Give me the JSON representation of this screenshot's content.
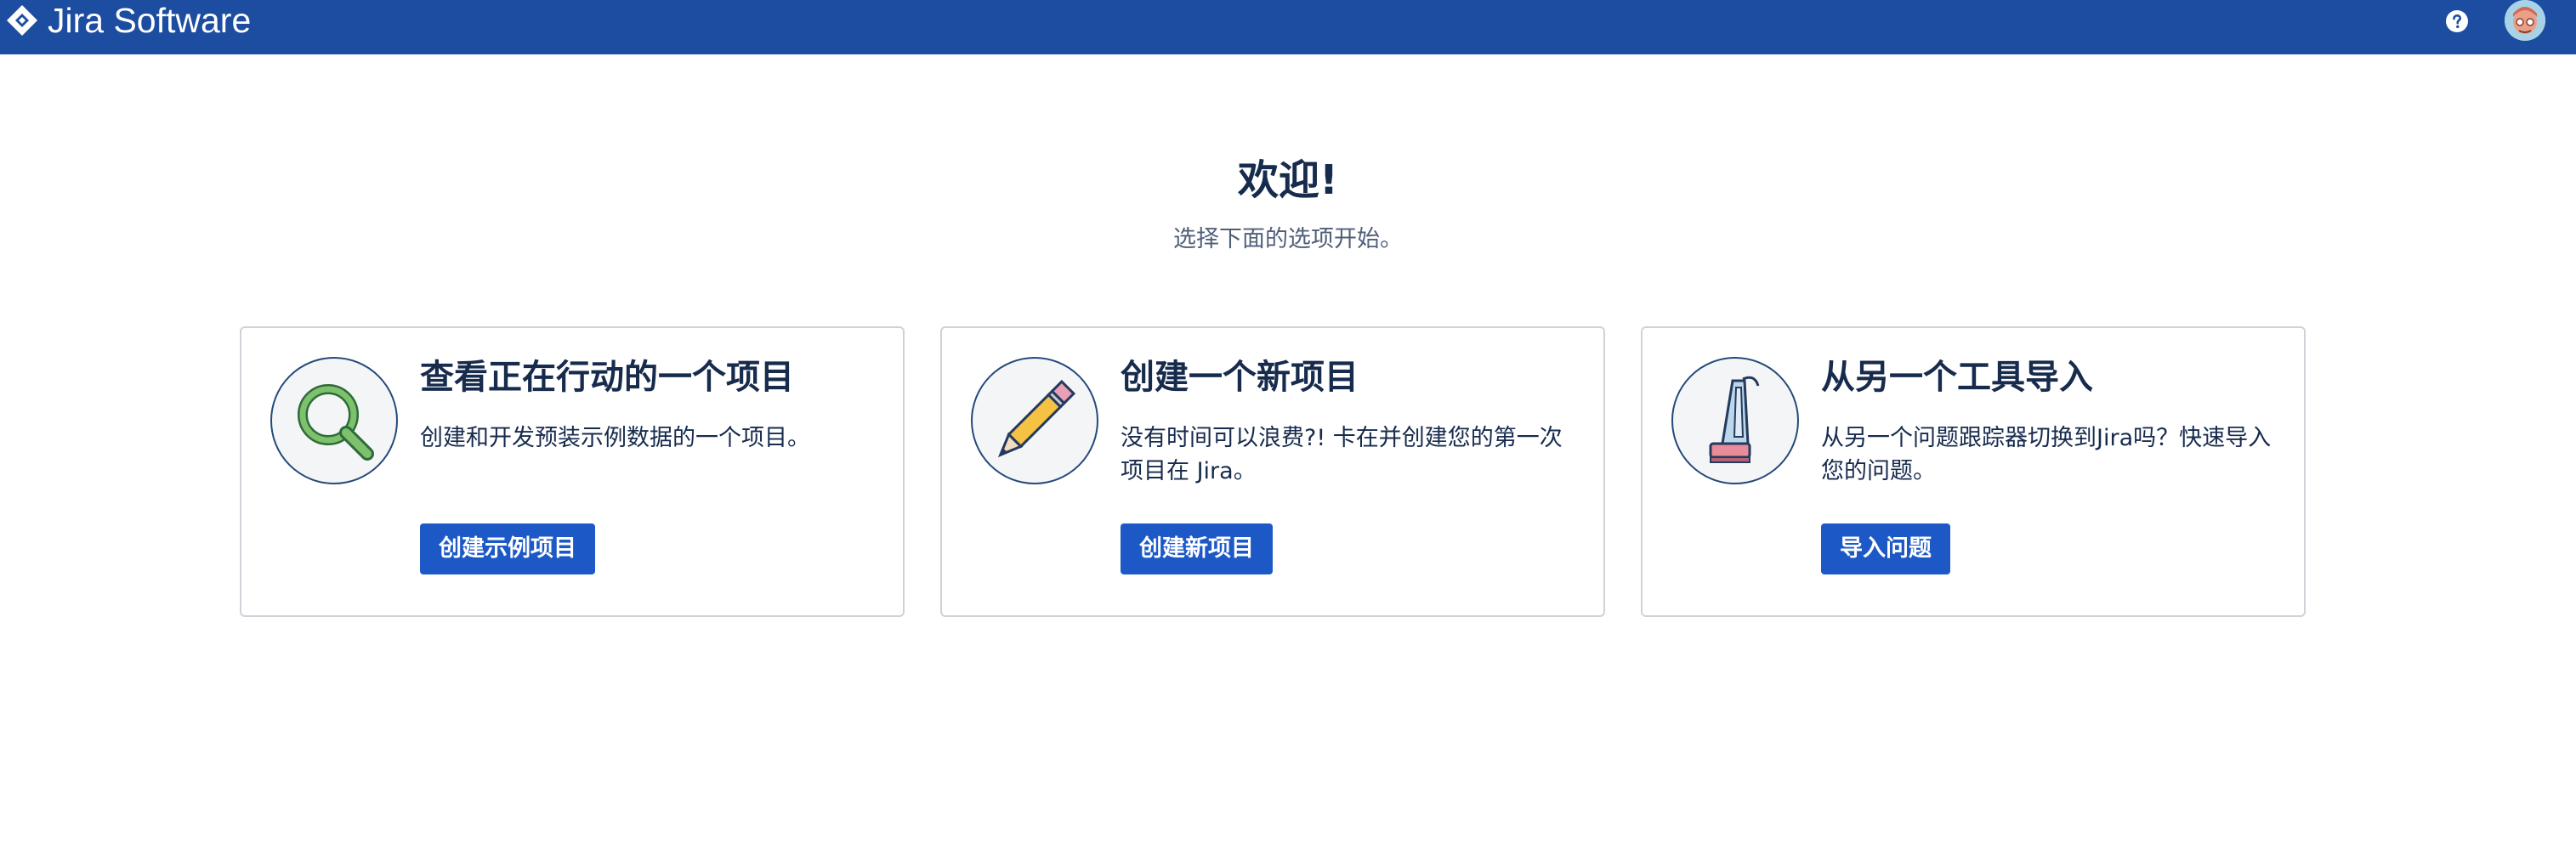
{
  "header": {
    "app_name": "Jira Software",
    "brand_color": "#1c4da1",
    "icons": {
      "logo": "jira-diamond-logo",
      "help": "help-question-icon",
      "avatar": "user-avatar"
    }
  },
  "welcome": {
    "title": "欢迎!",
    "subtitle": "选择下面的选项开始。"
  },
  "cards": [
    {
      "icon": "magnifier-icon",
      "title": "查看正在行动的一个项目",
      "description": "创建和开发预装示例数据的一个项目。",
      "button_label": "创建示例项目"
    },
    {
      "icon": "pencil-icon",
      "title": "创建一个新项目",
      "description": "没有时间可以浪费?! 卡在并创建您的第一次项目在 Jira。",
      "button_label": "创建新项目"
    },
    {
      "icon": "vacuum-icon",
      "title": "从另一个工具导入",
      "description": "从另一个问题跟踪器切换到Jira吗？快速导入您的问题。",
      "button_label": "导入问题"
    }
  ],
  "colors": {
    "button": "#1c59c7",
    "text_primary": "#172b4d",
    "text_secondary": "#505f79",
    "card_border": "#cfd3d9"
  }
}
